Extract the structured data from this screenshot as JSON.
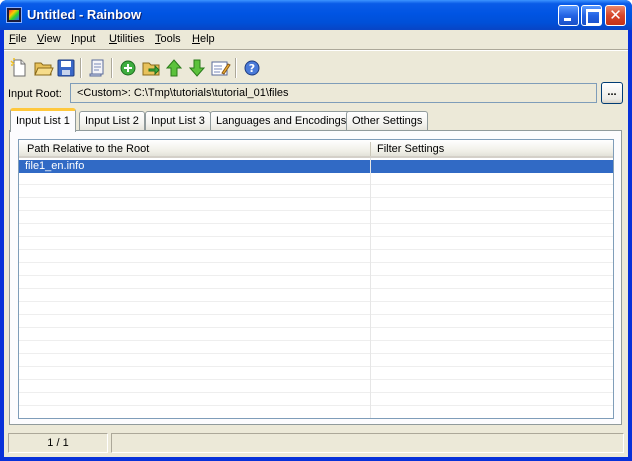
{
  "window": {
    "title": "Untitled - Rainbow"
  },
  "menu": [
    {
      "label": "File",
      "hotkey": "F",
      "rest": "ile"
    },
    {
      "label": "View",
      "hotkey": "V",
      "rest": "iew"
    },
    {
      "label": "Input",
      "hotkey": "I",
      "rest": "nput"
    },
    {
      "label": "Utilities",
      "hotkey": "U",
      "rest": "tilities"
    },
    {
      "label": "Tools",
      "hotkey": "T",
      "rest": "ools"
    },
    {
      "label": "Help",
      "hotkey": "H",
      "rest": "elp"
    }
  ],
  "toolbar": {
    "icons": [
      "new-file-icon",
      "open-folder-icon",
      "save-icon",
      "edit-scroll-icon",
      "add-circle-icon",
      "add-file-arrow-icon",
      "move-up-icon",
      "move-down-icon",
      "edit-properties-icon",
      "help-icon"
    ]
  },
  "input_root": {
    "label": "Input Root:",
    "value": "<Custom>:  C:\\Tmp\\tutorials\\tutorial_01\\files",
    "browse_label": "..."
  },
  "tabs": [
    {
      "label": "Input List 1",
      "active": true
    },
    {
      "label": "Input List 2",
      "active": false
    },
    {
      "label": "Input List 3",
      "active": false
    },
    {
      "label": "Languages and Encodings",
      "active": false
    },
    {
      "label": "Other Settings",
      "active": false
    }
  ],
  "list": {
    "columns": [
      "Path Relative to the Root",
      "Filter Settings"
    ],
    "rows": [
      {
        "path": "file1_en.info",
        "filter": "",
        "selected": true
      }
    ]
  },
  "status": {
    "position": "1 / 1",
    "message": ""
  },
  "colors": {
    "title_bar": "#0054e3",
    "selection": "#316ac5",
    "active_tab_highlight": "#ffc83c",
    "chrome": "#ece9d8"
  }
}
